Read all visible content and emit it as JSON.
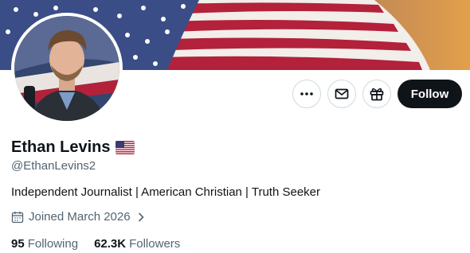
{
  "banner": {
    "image": "american-flag-banner"
  },
  "avatar": {
    "image": "profile-photo"
  },
  "actions": {
    "more_icon": "more-icon",
    "message_icon": "mail-icon",
    "gift_icon": "gift-icon",
    "follow_label": "Follow"
  },
  "profile": {
    "display_name": "Ethan Levins",
    "name_emoji": "us-flag",
    "handle": "@EthanLevins2",
    "bio": "Independent Journalist | American Christian | Truth Seeker",
    "joined": "Joined March 2026"
  },
  "stats": {
    "following_count": "95",
    "following_label": "Following",
    "followers_count": "62.3K",
    "followers_label": "Followers"
  },
  "colors": {
    "text_primary": "#0f1419",
    "text_secondary": "#536471",
    "border": "#cfd9de",
    "button_dark": "#0f1419"
  }
}
